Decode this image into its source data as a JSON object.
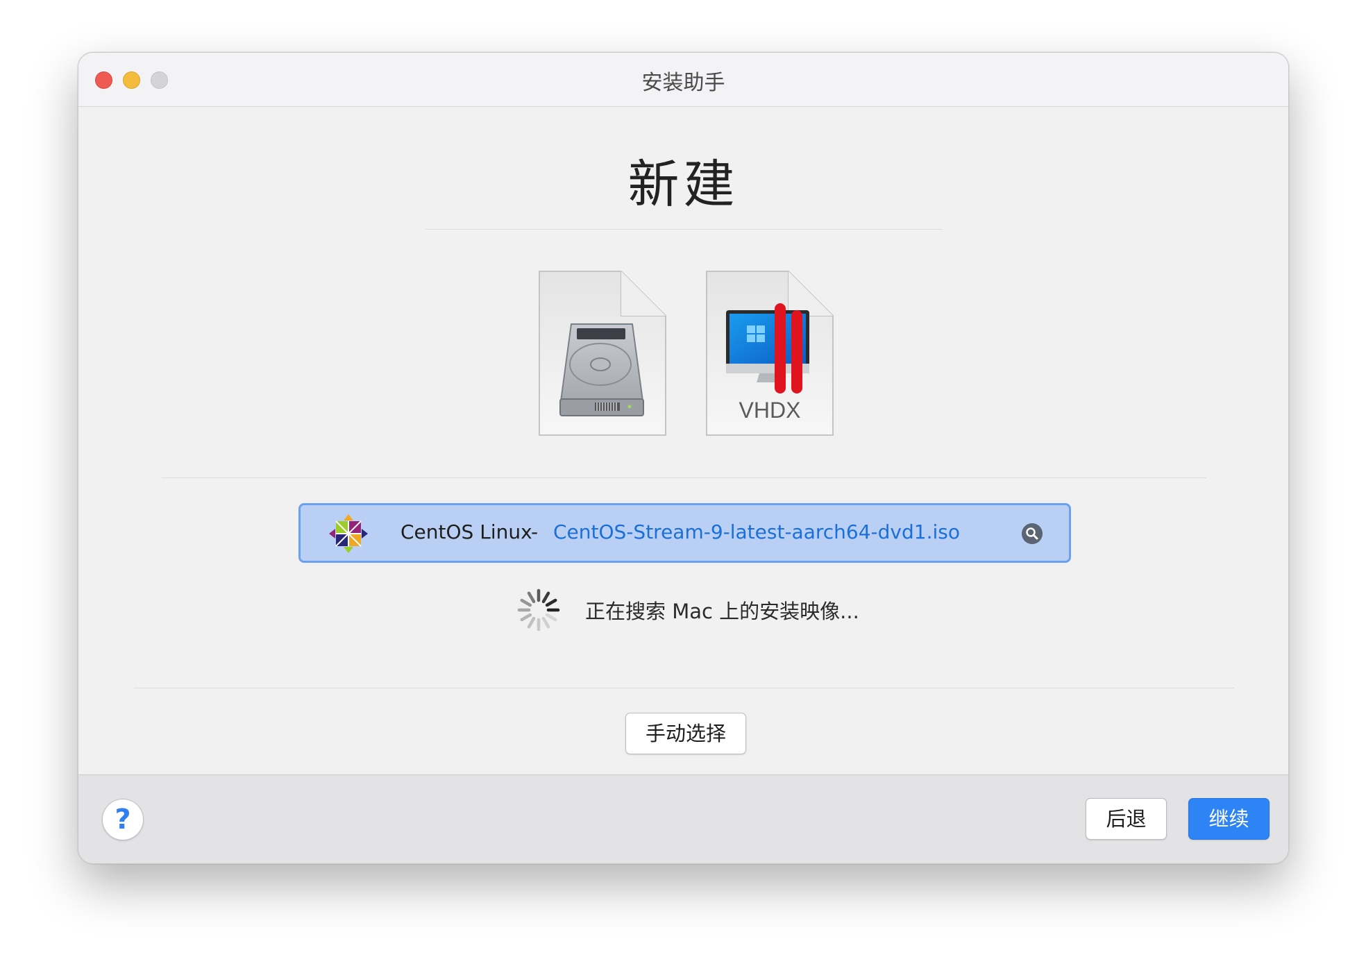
{
  "window": {
    "title": "安装助手"
  },
  "page": {
    "heading": "新建"
  },
  "sources": [
    {
      "name": "hard-disk-image",
      "label": ""
    },
    {
      "name": "vhdx-image",
      "label": "VHDX"
    }
  ],
  "iso_row": {
    "os_name": "CentOS Linux",
    "separator": "-",
    "file_name": "CentOS-Stream-9-latest-aarch64-dvd1.iso"
  },
  "status": {
    "searching_text": "正在搜索 Mac 上的安装映像..."
  },
  "buttons": {
    "manual_select": "手动选择",
    "help": "?",
    "back": "后退",
    "continue": "继续"
  },
  "colors": {
    "accent": "#2e84f4",
    "selection_fill": "#b9d0f4",
    "selection_border": "#6aa2ee",
    "link": "#1a6fd8",
    "close": "#ee5b52",
    "minimize": "#f3bc3c",
    "zoom_disabled": "#d4d4d6"
  }
}
